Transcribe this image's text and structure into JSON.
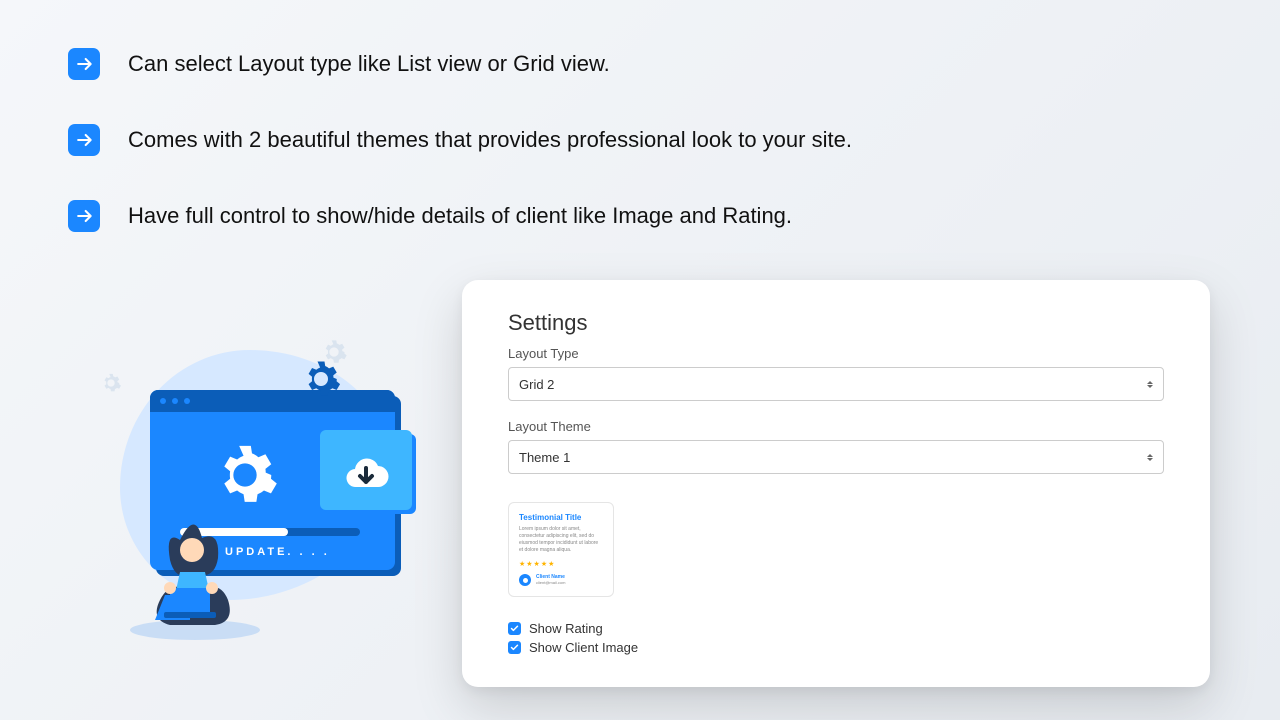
{
  "features": [
    "Can select Layout type like List view or Grid view.",
    "Comes with 2 beautiful themes that provides professional look to your site.",
    "Have full control to show/hide details of client like Image and Rating."
  ],
  "illustration": {
    "update_label": "UPDATE. . . ."
  },
  "panel": {
    "title": "Settings",
    "layout_type_label": "Layout Type",
    "layout_type_value": "Grid 2",
    "layout_theme_label": "Layout Theme",
    "layout_theme_value": "Theme 1",
    "preview": {
      "title": "Testimonial Title",
      "lorem": "Lorem ipsum dolor sit amet, consectetur adipiscing elit, sed do eiusmod tempor incididunt ut labore et dolore magna aliqua.",
      "stars": "★★★★★",
      "client_name": "Client Name",
      "client_email": "client@mail.com"
    },
    "show_rating_label": "Show Rating",
    "show_rating_checked": true,
    "show_client_image_label": "Show Client Image",
    "show_client_image_checked": true
  }
}
